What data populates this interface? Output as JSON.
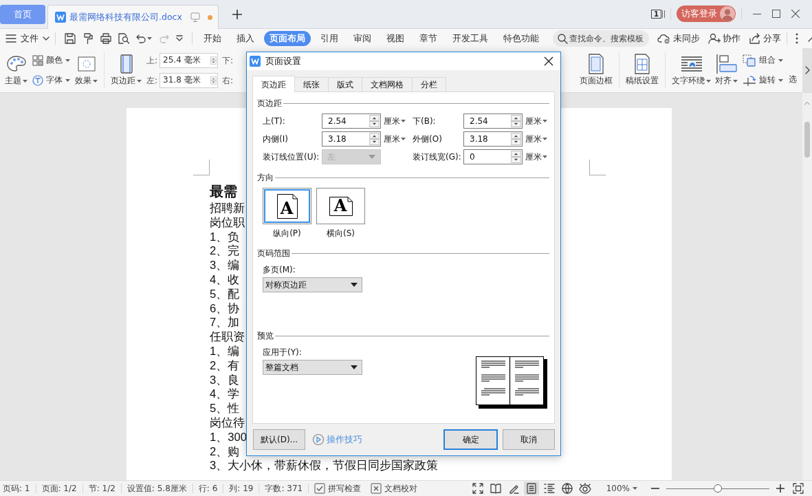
{
  "tabs": [
    {
      "label": "首页",
      "kind": "home",
      "selected": false
    },
    {
      "label": "最需网络科技有限公司.docx",
      "kind": "document",
      "selected": true,
      "unsaved": true
    }
  ],
  "window": {
    "page_count": "1",
    "login": "访客登录"
  },
  "menu": {
    "file": "文件",
    "tabs": [
      {
        "label": "开始",
        "selected": false
      },
      {
        "label": "插入",
        "selected": false
      },
      {
        "label": "页面布局",
        "selected": true
      },
      {
        "label": "引用",
        "selected": false
      },
      {
        "label": "审阅",
        "selected": false
      },
      {
        "label": "视图",
        "selected": false
      },
      {
        "label": "章节",
        "selected": false
      },
      {
        "label": "开发工具",
        "selected": false
      },
      {
        "label": "特色功能",
        "selected": false
      }
    ],
    "search": {
      "placeholder": "查找命令、搜索模板"
    },
    "actions": [
      "未同步",
      "协作",
      "分享"
    ]
  },
  "ribbon": {
    "left": [
      [
        {
          "kind": "big",
          "label": "主题",
          "dropdown": true
        },
        {
          "kind": "stack",
          "items": [
            {
              "label": "颜色",
              "dropdown": true
            },
            {
              "label": "字体",
              "dropdown": true
            }
          ]
        },
        {
          "kind": "big",
          "label": "效果",
          "dropdown": true
        }
      ],
      [
        {
          "kind": "big",
          "label": "页边距",
          "dropdown": true
        },
        {
          "kind": "fields",
          "items": [
            {
              "label": "上:",
              "value": "25.4 毫米"
            },
            {
              "label": "左:",
              "value": "31.8 毫米"
            }
          ]
        },
        {
          "kind": "labels",
          "items": [
            "下:",
            "右:"
          ]
        }
      ]
    ],
    "right": [
      [
        {
          "kind": "big",
          "label": "页面边框",
          "dropdown": false
        }
      ],
      [
        {
          "kind": "big",
          "label": "稿纸设置",
          "dropdown": false
        }
      ],
      [
        {
          "kind": "big",
          "label": "文字环绕",
          "dropdown": true
        },
        {
          "kind": "big",
          "label": "对齐",
          "dropdown": true
        },
        {
          "kind": "stack",
          "items": [
            {
              "label": "组合",
              "dropdown": true
            },
            {
              "label": "旋转",
              "dropdown": true
            }
          ]
        },
        {
          "kind": "text",
          "label": "选"
        }
      ]
    ]
  },
  "document": {
    "title": "最需",
    "lines": [
      "招聘新",
      "岗位职",
      "1、负",
      "2、完",
      "3、编",
      "4、收",
      "5、配",
      "6、协",
      "7、加",
      "任职资",
      "1、编",
      "2、有",
      "3、良",
      "4、学",
      "5、性",
      "岗位待",
      "1、300",
      "2、购",
      "3、大小休，带薪休假，节假日同步国家政策"
    ]
  },
  "dialog": {
    "title": "页面设置",
    "tabs": [
      {
        "label": "页边距",
        "selected": true
      },
      {
        "label": "纸张",
        "selected": false
      },
      {
        "label": "版式",
        "selected": false
      },
      {
        "label": "文档网格",
        "selected": false
      },
      {
        "label": "分栏",
        "selected": false
      }
    ],
    "margins": {
      "heading": "页边距",
      "fields": [
        {
          "kind": "spin",
          "label": "上(T):",
          "value": "2.54",
          "unit": "厘米",
          "disabled": false
        },
        {
          "kind": "spin",
          "label": "下(B):",
          "value": "2.54",
          "unit": "厘米",
          "disabled": false
        },
        {
          "kind": "spin",
          "label": "内侧(I)",
          "value": "3.18",
          "unit": "厘米",
          "disabled": false
        },
        {
          "kind": "spin",
          "label": "外侧(O)",
          "value": "3.18",
          "unit": "厘米",
          "disabled": false
        },
        {
          "kind": "select",
          "label": "装订线位置(U):",
          "value": "左",
          "disabled": true
        },
        {
          "kind": "spin",
          "label": "装订线宽(G):",
          "value": "0",
          "unit": "厘米",
          "disabled": false
        }
      ]
    },
    "orientation": {
      "heading": "方向",
      "options": [
        {
          "label": "纵向(P)",
          "kind": "portrait",
          "letter": "A",
          "selected": true
        },
        {
          "label": "横向(S)",
          "kind": "landscape",
          "letter": "A",
          "selected": false
        }
      ]
    },
    "pages": {
      "heading": "页码范围",
      "label": "多页(M):",
      "value": "对称页边距"
    },
    "preview": {
      "heading": "预览",
      "label": "应用于(Y):",
      "value": "整篇文档"
    },
    "buttons": {
      "default": "默认(D)...",
      "tips": "操作技巧",
      "ok": "确定",
      "cancel": "取消"
    }
  },
  "status_bar": {
    "items": [
      "页码: 1",
      "页面: 1/2",
      "节: 1/2",
      "设置值: 5.8厘米",
      "行: 6",
      "列: 19",
      "字数: 371"
    ],
    "tools": [
      "拼写检查",
      "文档校对"
    ],
    "view_modes": [
      {
        "selected": false
      },
      {
        "selected": false
      },
      {
        "selected": false
      },
      {
        "selected": true
      },
      {
        "selected": false
      },
      {
        "selected": false
      },
      {
        "selected": false
      }
    ],
    "zoom": {
      "label": "100%",
      "level": 0.5
    }
  }
}
